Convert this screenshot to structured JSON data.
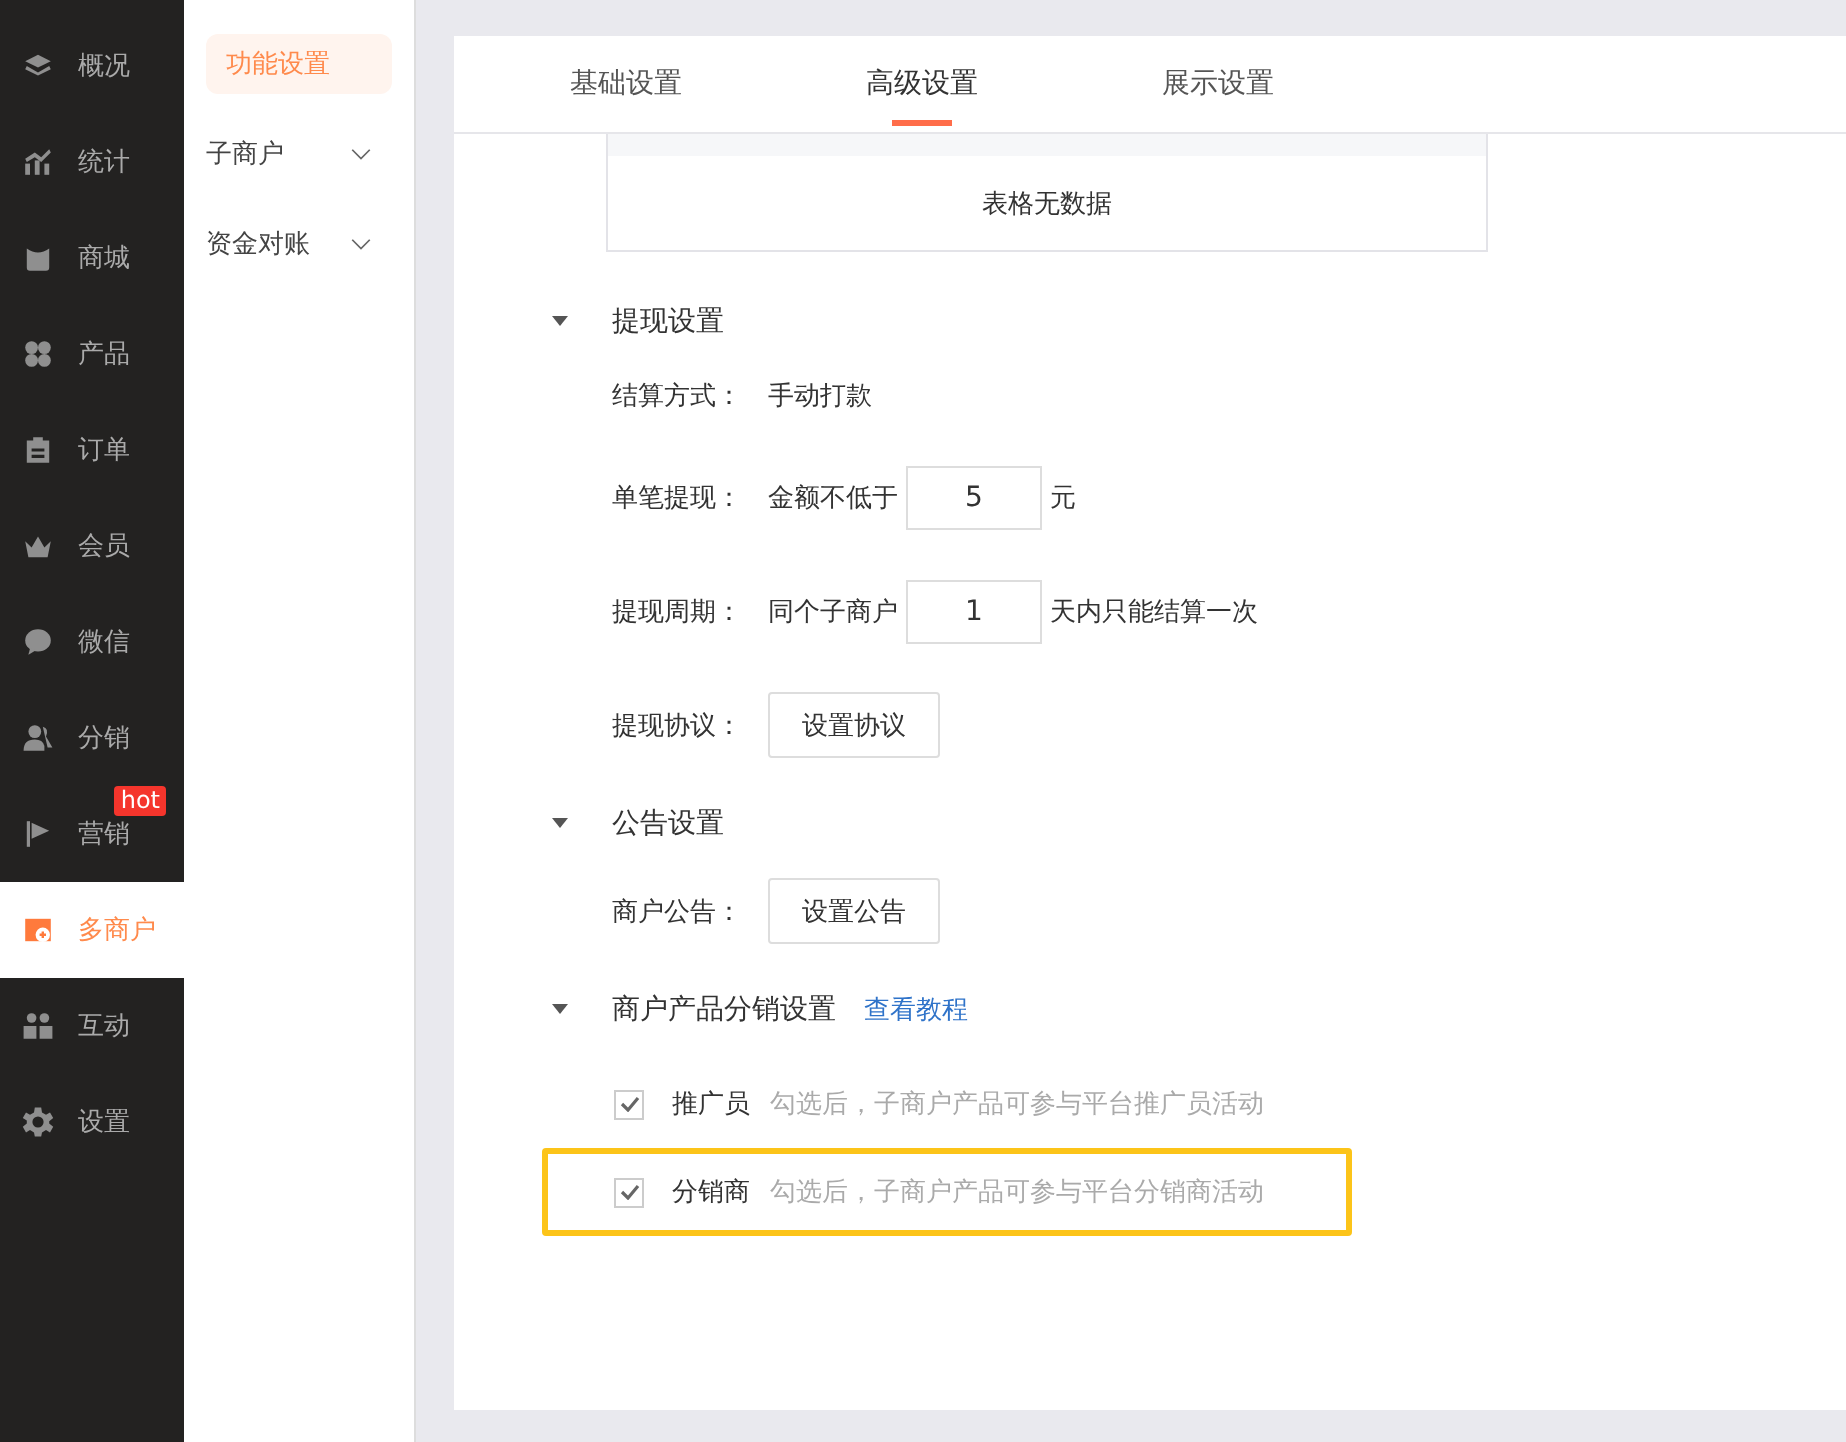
{
  "sidebar": {
    "items": [
      {
        "label": "概况",
        "selected": false
      },
      {
        "label": "统计",
        "selected": false
      },
      {
        "label": "商城",
        "selected": false
      },
      {
        "label": "产品",
        "selected": false
      },
      {
        "label": "订单",
        "selected": false
      },
      {
        "label": "会员",
        "selected": false
      },
      {
        "label": "微信",
        "selected": false
      },
      {
        "label": "分销",
        "selected": false
      },
      {
        "label": "营销",
        "selected": false,
        "badge": "hot"
      },
      {
        "label": "多商户",
        "selected": true
      },
      {
        "label": "互动",
        "selected": false
      },
      {
        "label": "设置",
        "selected": false
      }
    ]
  },
  "subnav": {
    "items": [
      {
        "label": "功能设置",
        "selected": true,
        "expandable": false
      },
      {
        "label": "子商户",
        "selected": false,
        "expandable": true
      },
      {
        "label": "资金对账",
        "selected": false,
        "expandable": true
      }
    ]
  },
  "tabs": [
    {
      "label": "基础设置",
      "selected": false
    },
    {
      "label": "高级设置",
      "selected": true
    },
    {
      "label": "展示设置",
      "selected": false
    }
  ],
  "table": {
    "empty_text": "表格无数据"
  },
  "sections": [
    {
      "title": "提现设置",
      "expanded": true,
      "rows": [
        {
          "kind": "text",
          "label": "结算方式：",
          "value": "手动打款"
        },
        {
          "kind": "input",
          "label": "单笔提现：",
          "prefix": "金额不低于",
          "value": "5",
          "suffix": "元"
        },
        {
          "kind": "input",
          "label": "提现周期：",
          "prefix": "同个子商户",
          "value": "1",
          "suffix": "天内只能结算一次"
        },
        {
          "kind": "button",
          "label": "提现协议：",
          "button": "设置协议"
        }
      ]
    },
    {
      "title": "公告设置",
      "expanded": true,
      "rows": [
        {
          "kind": "button",
          "label": "商户公告：",
          "button": "设置公告"
        }
      ]
    },
    {
      "title": "商户产品分销设置",
      "link": "查看教程",
      "expanded": true,
      "rows": [
        {
          "kind": "checkbox",
          "label": "推广员",
          "hint": "勾选后，子商户产品可参与平台推广员活动",
          "checked": true,
          "highlighted": false
        },
        {
          "kind": "checkbox",
          "label": "分销商",
          "hint": "勾选后，子商户产品可参与平台分销商活动",
          "checked": true,
          "highlighted": true
        }
      ]
    }
  ]
}
